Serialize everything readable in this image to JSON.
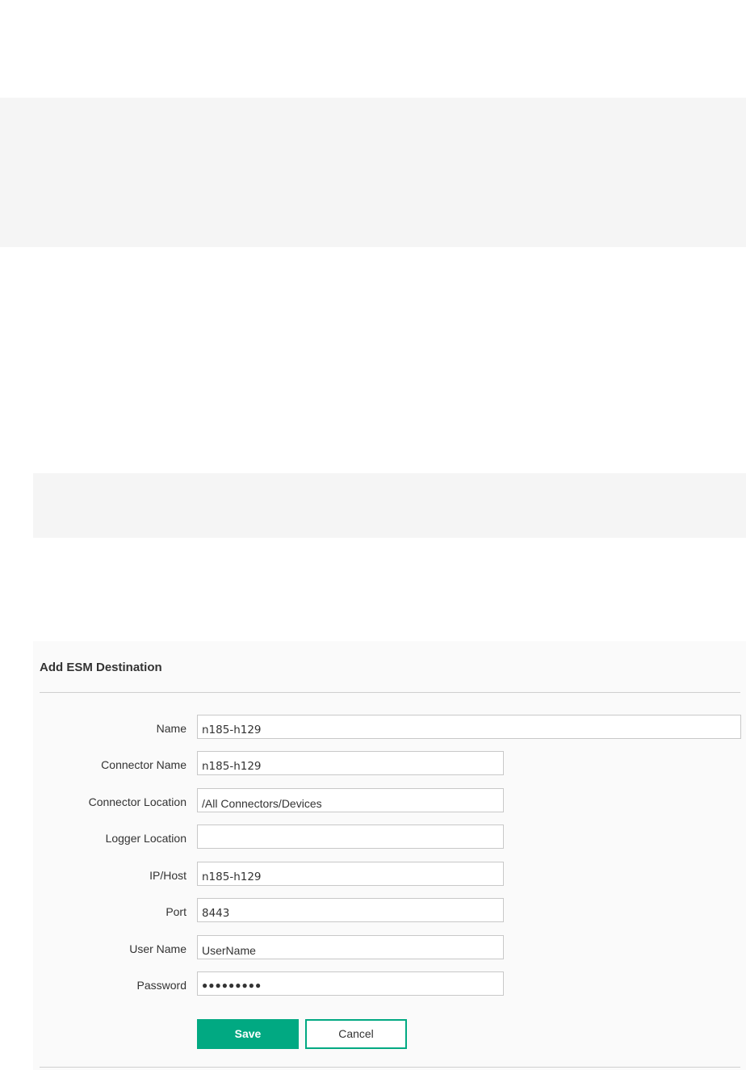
{
  "form": {
    "title": "Add ESM Destination",
    "fields": [
      {
        "label": "Name",
        "value": "n185-h129"
      },
      {
        "label": "Connector Name",
        "value": "n185-h129"
      },
      {
        "label": "Connector Location",
        "value": "/All Connectors/Devices"
      },
      {
        "label": "Logger Location",
        "value": ""
      },
      {
        "label": "IP/Host",
        "value": "n185-h129"
      },
      {
        "label": "Port",
        "value": "8443"
      },
      {
        "label": "User Name",
        "value": "UserName"
      },
      {
        "label": "Password",
        "value": "●●●●●●●●●"
      }
    ],
    "save_label": "Save",
    "cancel_label": "Cancel"
  },
  "colors": {
    "accent": "#01a982",
    "band": "#f5f5f5",
    "panel": "#fafafa"
  }
}
